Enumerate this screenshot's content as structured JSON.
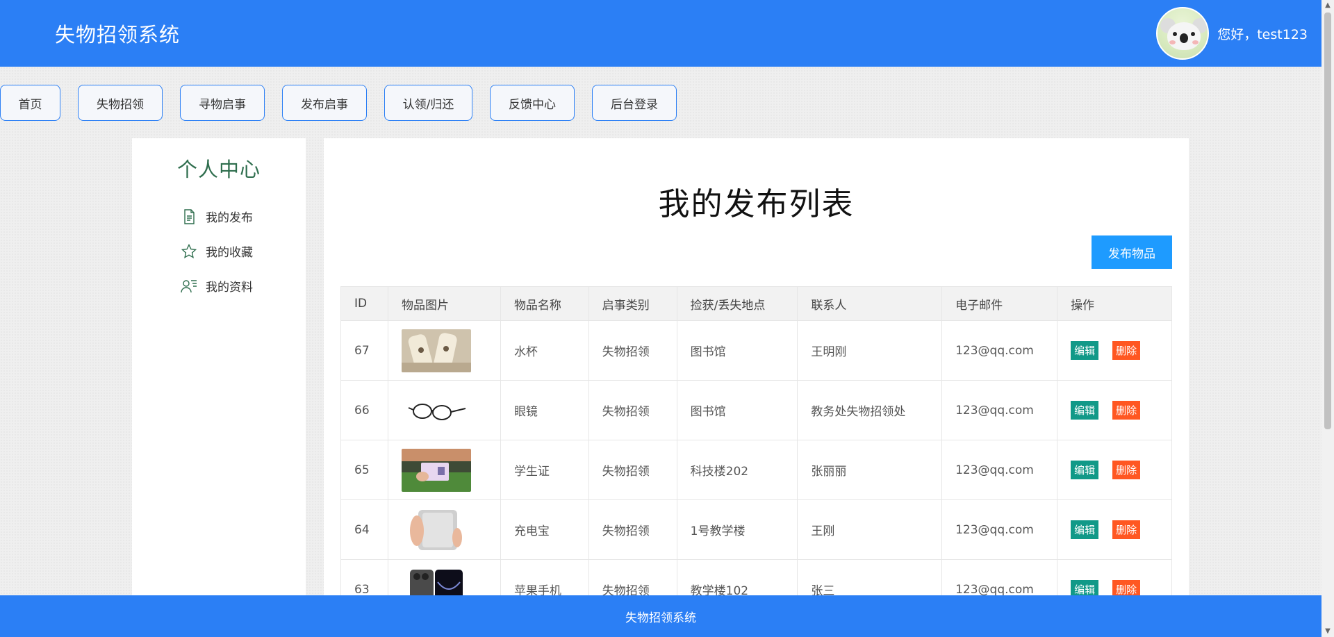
{
  "header": {
    "title": "失物招领系统",
    "greeting": "您好，test123"
  },
  "nav": [
    {
      "label": "首页"
    },
    {
      "label": "失物招领"
    },
    {
      "label": "寻物启事"
    },
    {
      "label": "发布启事"
    },
    {
      "label": "认领/归还"
    },
    {
      "label": "反馈中心"
    },
    {
      "label": "后台登录"
    }
  ],
  "sidebar": {
    "title": "个人中心",
    "items": [
      {
        "label": "我的发布",
        "icon": "document-icon"
      },
      {
        "label": "我的收藏",
        "icon": "star-icon"
      },
      {
        "label": "我的资料",
        "icon": "user-card-icon"
      }
    ]
  },
  "main": {
    "title": "我的发布列表",
    "publish_button": "发布物品",
    "columns": [
      "ID",
      "物品图片",
      "物品名称",
      "启事类别",
      "捡获/丢失地点",
      "联系人",
      "电子邮件",
      "操作"
    ],
    "rows": [
      {
        "id": "67",
        "name": "水杯",
        "category": "失物招领",
        "location": "图书馆",
        "contact": "王明刚",
        "email": "123@qq.com"
      },
      {
        "id": "66",
        "name": "眼镜",
        "category": "失物招领",
        "location": "图书馆",
        "contact": "教务处失物招领处",
        "email": "123@qq.com"
      },
      {
        "id": "65",
        "name": "学生证",
        "category": "失物招领",
        "location": "科技楼202",
        "contact": "张丽丽",
        "email": "123@qq.com"
      },
      {
        "id": "64",
        "name": "充电宝",
        "category": "失物招领",
        "location": "1号教学楼",
        "contact": "王刚",
        "email": "123@qq.com"
      },
      {
        "id": "63",
        "name": "苹果手机",
        "category": "失物招领",
        "location": "教学楼102",
        "contact": "张三",
        "email": "123@qq.com"
      }
    ],
    "edit_label": "编辑",
    "delete_label": "删除"
  },
  "footer": {
    "text": "失物招领系统"
  },
  "colors": {
    "primary": "#2b7ff5",
    "publish": "#1e9bff",
    "edit": "#119988",
    "delete": "#ff5722",
    "sidebar_title": "#2f6e4e"
  }
}
